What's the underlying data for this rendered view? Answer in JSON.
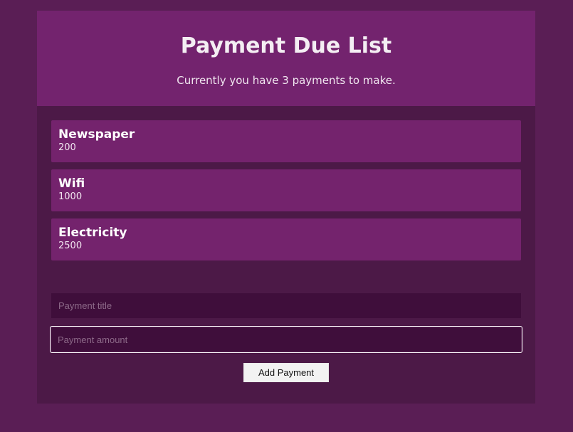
{
  "header": {
    "title": "Payment Due List",
    "subtitle": "Currently you have 3 payments to make."
  },
  "payments": [
    {
      "title": "Newspaper",
      "amount": "200"
    },
    {
      "title": "Wifi",
      "amount": "1000"
    },
    {
      "title": "Electricity",
      "amount": "2500"
    }
  ],
  "form": {
    "title_placeholder": "Payment title",
    "amount_placeholder": "Payment amount",
    "submit_label": "Add Payment"
  },
  "colors": {
    "page_background": "#5a1e55",
    "card_background": "#4c1947",
    "header_background": "#73236e",
    "item_background": "#74236d",
    "input_background": "#3f0e3b"
  }
}
